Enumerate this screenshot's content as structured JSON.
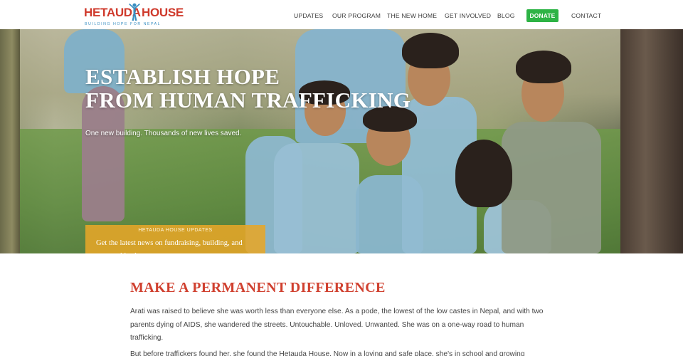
{
  "header": {
    "logo": {
      "word1": "HETAUDA",
      "word2": "HOUSE",
      "tagline": "BUILDING HOPE FOR NEPAL",
      "icon": "person-arms-raised-icon"
    },
    "nav": [
      {
        "label": "UPDATES"
      },
      {
        "label": "OUR PROGRAM"
      },
      {
        "label": "THE NEW HOME"
      },
      {
        "label": "GET INVOLVED"
      },
      {
        "label": "BLOG"
      },
      {
        "label": "DONATE"
      },
      {
        "label": "CONTACT"
      }
    ]
  },
  "hero": {
    "title_line1": "ESTABLISH HOPE",
    "title_line2": "FROM HUMAN TRAFFICKING",
    "subtitle": "One new building. Thousands of new lives saved.",
    "cta": {
      "kicker": "HETAUDA HOUSE UPDATES",
      "text": "Get the latest news on fundraising, building, and partnerships here"
    }
  },
  "main": {
    "heading": "MAKE A PERMANENT DIFFERENCE",
    "paragraphs": [
      "Arati was raised to believe she was worth less than everyone else. As a pode, the lowest of the low castes in Nepal, and with two parents dying of AIDS, she wandered the streets. Untouchable. Unloved. Unwanted. She was on a one-way road to human trafficking.",
      "But before traffickers found her, she found the Hetauda House. Now in a loving and safe place, she's in school and growing"
    ]
  },
  "colors": {
    "brand_red": "#cf3a2c",
    "brand_blue": "#3a8fc2",
    "donate_green": "#2db345",
    "cta_gold": "#e6a628",
    "heading_red": "#d0402f"
  }
}
